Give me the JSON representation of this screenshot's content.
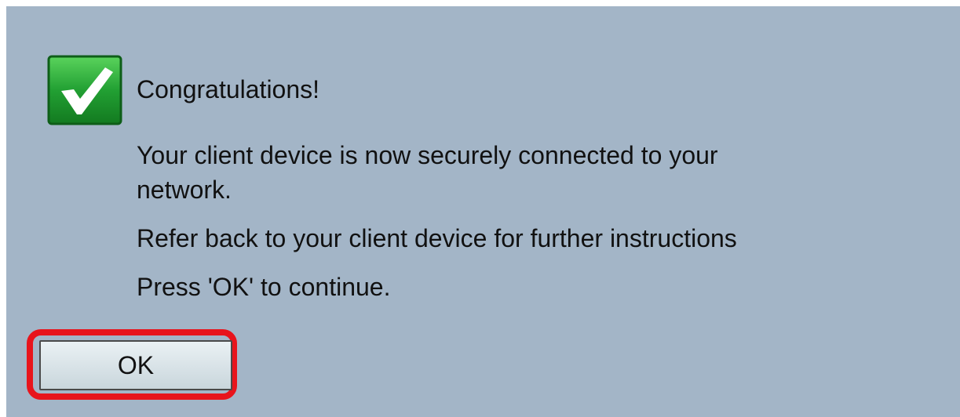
{
  "dialog": {
    "heading": "Congratulations!",
    "message_line1": "Your client device is now securely connected to your",
    "message_line2": "network.",
    "message_line3": "Refer back to your client device for further instructions",
    "message_line4": "Press 'OK' to continue.",
    "ok_label": "OK"
  },
  "icons": {
    "status": "checkmark-icon"
  },
  "colors": {
    "background": "#a3b5c7",
    "check_green": "#22a033",
    "highlight_red": "#e8141c"
  }
}
